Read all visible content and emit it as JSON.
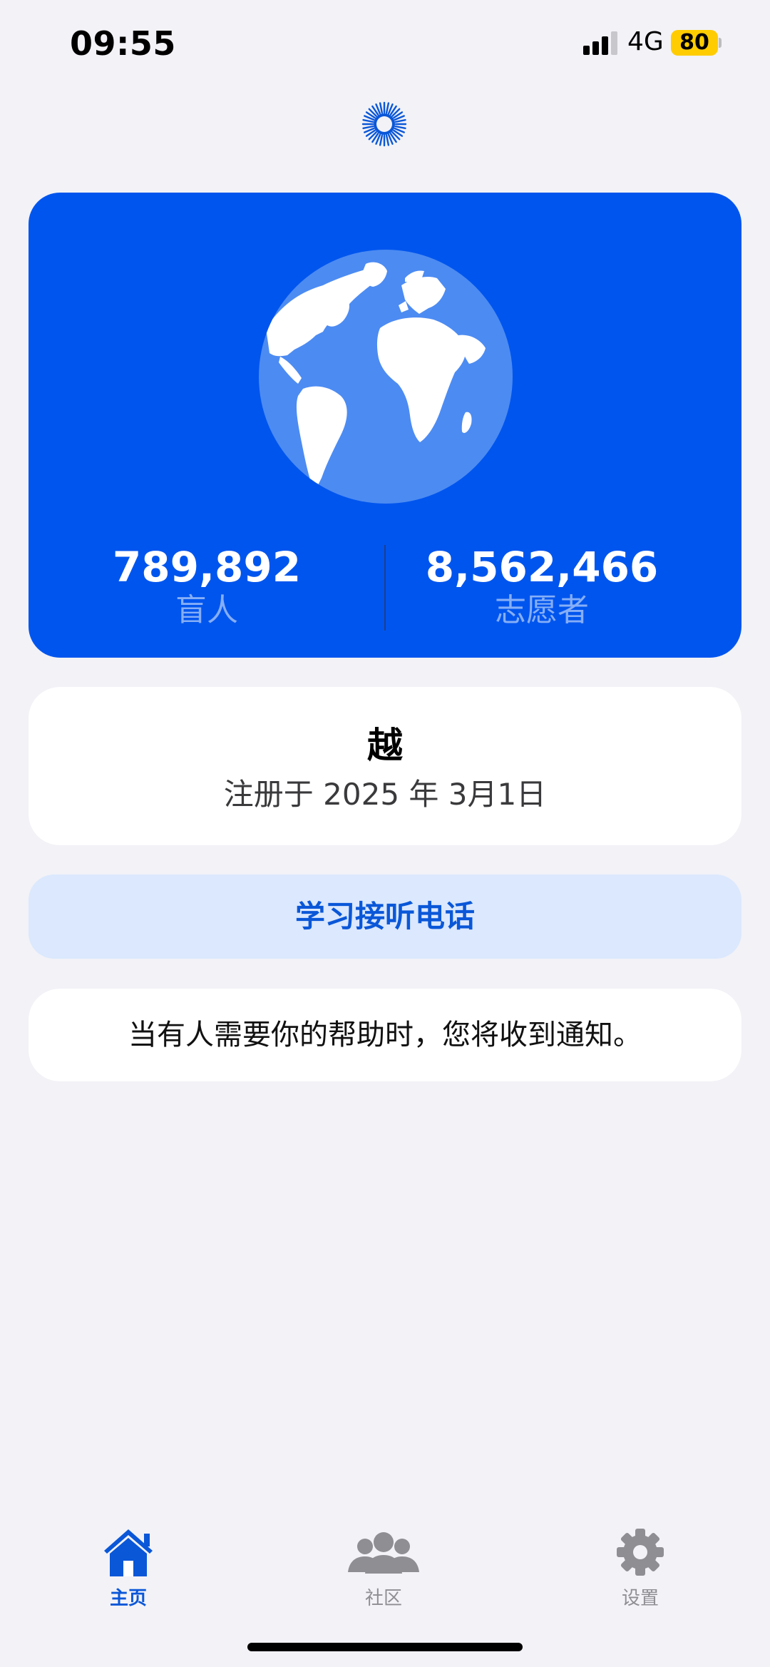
{
  "status_bar": {
    "time": "09:55",
    "network": "4G",
    "battery": "80",
    "battery_color": "#ffcc00"
  },
  "stats": {
    "blind": {
      "value": "789,892",
      "label": "盲人"
    },
    "volunteers": {
      "value": "8,562,466",
      "label": "志愿者"
    }
  },
  "user": {
    "name": "越",
    "registered": "注册于 2025 年 3月1日"
  },
  "learn_button": {
    "label": "学习接听电话"
  },
  "notice": {
    "text": "当有人需要你的帮助时，您将收到通知。"
  },
  "tabs": [
    {
      "label": "主页",
      "icon": "home-icon",
      "active": true
    },
    {
      "label": "社区",
      "icon": "community-icon",
      "active": false
    },
    {
      "label": "设置",
      "icon": "gear-icon",
      "active": false
    }
  ],
  "colors": {
    "brand_blue": "#0055ee",
    "accent": "#0a57d8",
    "background": "#f2f2f7",
    "inactive": "#8e8e93"
  }
}
